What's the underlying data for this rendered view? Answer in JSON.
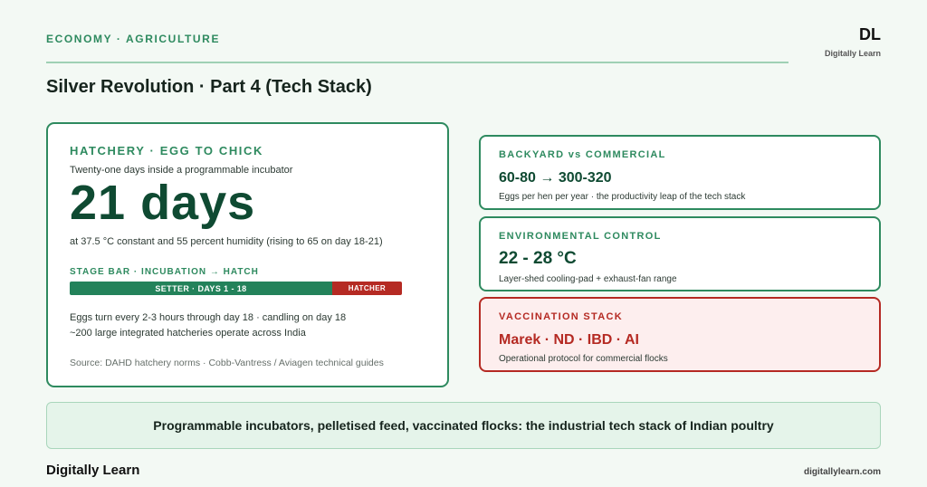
{
  "header": {
    "eyebrow": "ECONOMY · AGRICULTURE",
    "title": "Silver Revolution · Part 4 (Tech Stack)",
    "brand_mark": "DL",
    "brand_sub": "Digitally Learn"
  },
  "hatchery": {
    "kicker": "HATCHERY · EGG TO CHICK",
    "subtitle": "Twenty-one days inside a programmable incubator",
    "big_value": "21 days",
    "conditions": "at 37.5 °C constant and 55 percent humidity (rising to 65 on day 18-21)",
    "stage_label": "STAGE BAR · INCUBATION → HATCH",
    "stage_setter": "SETTER · DAYS 1 - 18",
    "stage_hatcher": "HATCHER",
    "setter_fraction": 0.79,
    "note_1": "Eggs turn every 2-3 hours through day 18 · candling on day 18",
    "note_2": "~200 large integrated hatcheries operate across India",
    "source": "Source: DAHD hatchery norms · Cobb-Vantress / Aviagen technical guides"
  },
  "cards": [
    {
      "kicker": "BACKYARD vs COMMERCIAL",
      "value": "60-80 → 300-320",
      "caption": "Eggs per hen per year · the productivity leap of the tech stack"
    },
    {
      "kicker": "ENVIRONMENTAL CONTROL",
      "value": "22 - 28 °C",
      "caption": "Layer-shed cooling-pad + exhaust-fan range"
    },
    {
      "kicker": "VACCINATION STACK",
      "value": "Marek · ND · IBD · AI",
      "caption": "Operational protocol for commercial flocks"
    }
  ],
  "colors": {
    "accent_green": "#2e8a5f",
    "dark_green": "#0f4a32",
    "alert_red": "#b52a23"
  },
  "banner": "Programmable incubators, pelletised feed, vaccinated flocks: the industrial tech stack of Indian poultry",
  "footer": {
    "brand": "Digitally Learn",
    "url": "digitallylearn.com"
  }
}
